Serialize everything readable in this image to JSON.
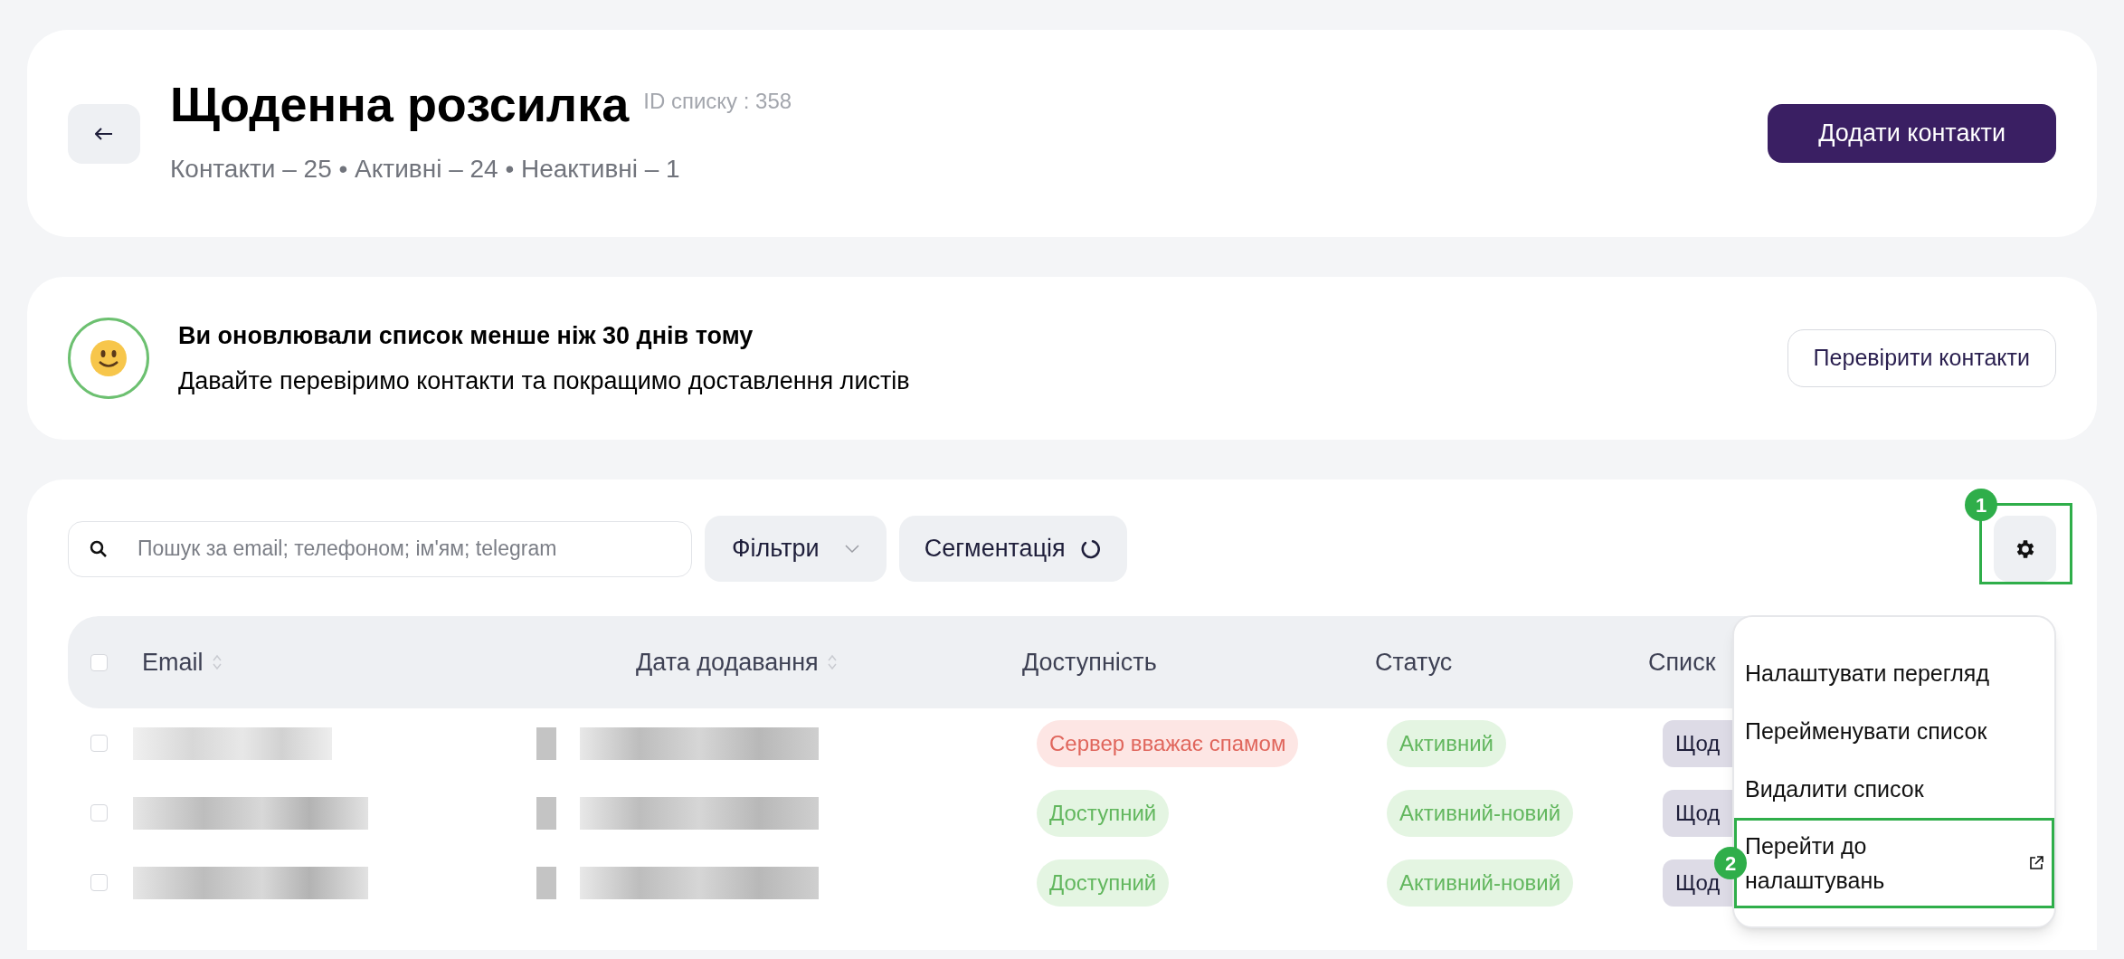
{
  "header": {
    "title": "Щоденна розсилка",
    "list_id": "ID списку : 358",
    "stats": "Контакти – 25 • Активні – 24 • Неактивні – 1",
    "add_button": "Додати контакти"
  },
  "notice": {
    "title": "Ви оновлювали список менше ніж 30 днів тому",
    "text": "Давайте перевіримо контакти та покращимо доставлення листів",
    "button": "Перевірити контакти"
  },
  "toolbar": {
    "search": {
      "placeholder": "Пошук за email; телефоном; ім'ям; telegram"
    },
    "filters": "Фільтри",
    "segmentation": "Сегментація"
  },
  "table": {
    "select_all": {
      "checked": false
    },
    "columns": [
      {
        "label": "Email",
        "sortable": true
      },
      {
        "label": "Дата додавання",
        "sortable": true
      },
      {
        "label": "Доступність",
        "sortable": false
      },
      {
        "label": "Статус",
        "sortable": false
      },
      {
        "label": "Списк",
        "sortable": false
      }
    ],
    "rows": [
      {
        "checked": false,
        "availability": {
          "text": "Сервер вважає спамом",
          "kind": "bad"
        },
        "status": "Активний",
        "list": "Щод"
      },
      {
        "checked": false,
        "availability": {
          "text": "Доступний",
          "kind": "good"
        },
        "status": "Активний-новий",
        "list": "Щод"
      },
      {
        "checked": false,
        "availability": {
          "text": "Доступний",
          "kind": "good"
        },
        "status": "Активний-новий",
        "list": "Щод"
      }
    ]
  },
  "settings_menu": {
    "expanded": true,
    "items": [
      {
        "label": "Налаштувати перегляд",
        "external": false
      },
      {
        "label": "Перейменувати список",
        "external": false
      },
      {
        "label": "Видалити список",
        "external": false
      },
      {
        "label": "Перейти до налаштувань",
        "external": true
      }
    ]
  },
  "annotations": [
    {
      "label": "1"
    },
    {
      "label": "2"
    }
  ]
}
